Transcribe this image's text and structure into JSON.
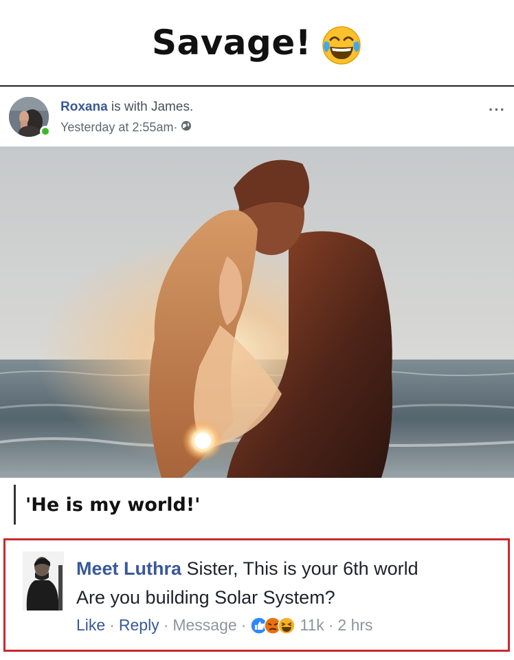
{
  "meme": {
    "title": "Savage!",
    "emoji_icon": "tears-of-joy-emoji"
  },
  "post": {
    "author": "Roxana",
    "with_text": " is with James.",
    "timestamp": "Yesterday at 2:55am",
    "separator": " ·",
    "privacy_icon": "globe-icon",
    "more_label": "···",
    "status_color": "#42b72a"
  },
  "caption": {
    "text": "'He is my world!'"
  },
  "comment": {
    "author": "Meet Luthra",
    "line1": " Sister, This is your 6th world",
    "line2": "Are you building Solar System?",
    "like": "Like",
    "reply": "Reply",
    "message": "Message",
    "sep": "·",
    "reaction_icons": [
      "like-icon",
      "angry-icon",
      "haha-icon"
    ],
    "reaction_count": "11k",
    "time": "2 hrs",
    "highlight_color": "#c9282d"
  }
}
